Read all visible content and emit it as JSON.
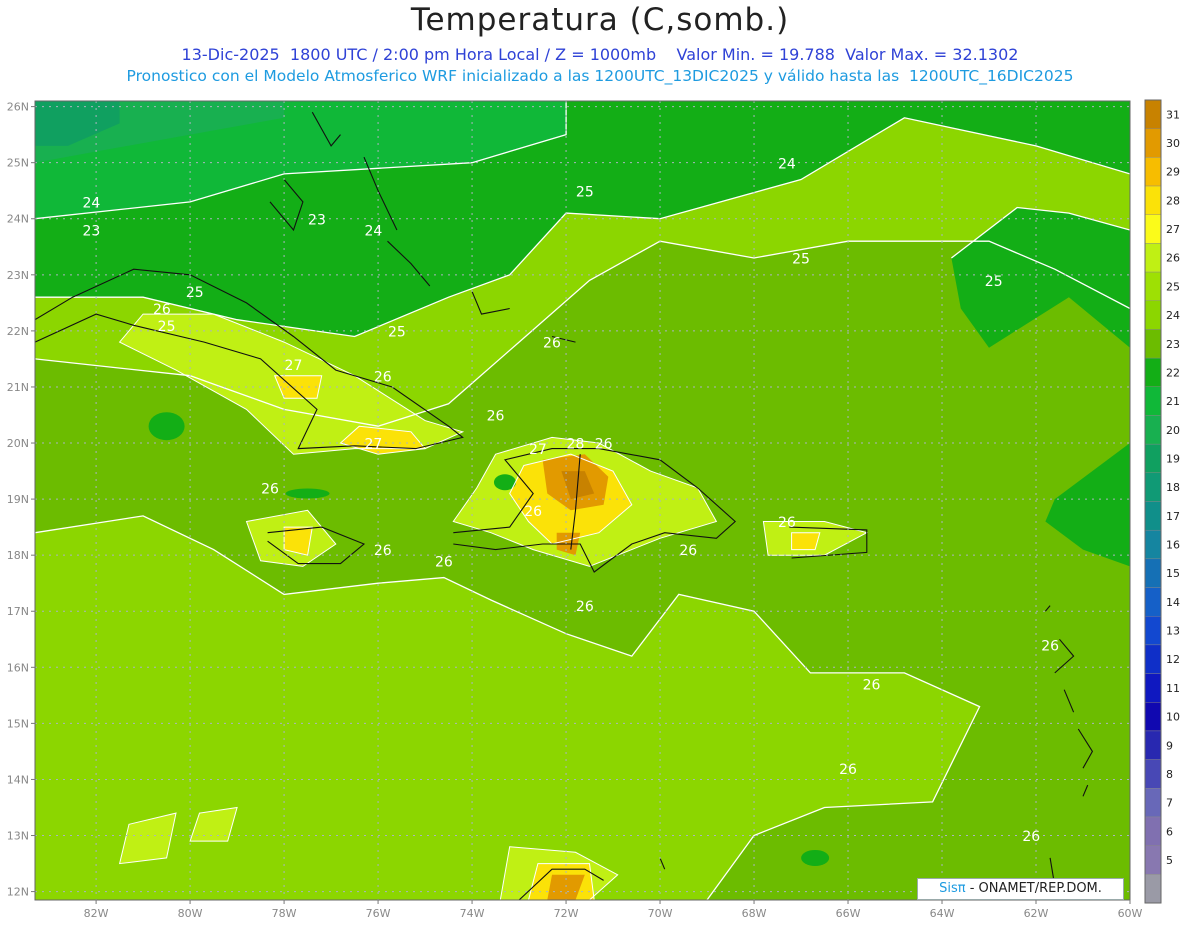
{
  "header": {
    "title": "Temperatura (C,somb.)",
    "subtitle_1": "13-Dic-2025  1800 UTC / 2:00 pm Hora Local / Z = 1000mb    Valor Min. = 19.788  Valor Max. = 32.1302",
    "subtitle_2": "Pronostico con el Modelo Atmosferico WRF inicializado a las 1200UTC_13DIC2025 y válido hasta las  1200UTC_16DIC2025"
  },
  "map": {
    "lat_labels": [
      "26N",
      "25N",
      "24N",
      "23N",
      "22N",
      "21N",
      "20N",
      "19N",
      "18N",
      "17N",
      "16N",
      "15N",
      "14N",
      "13N",
      "12N"
    ],
    "lon_labels": [
      "82W",
      "80W",
      "78W",
      "76W",
      "74W",
      "72W",
      "70W",
      "68W",
      "66W",
      "64W",
      "62W",
      "60W"
    ],
    "contour_labels": [
      {
        "text": "24",
        "lon": -67.3,
        "lat": 24.9
      },
      {
        "text": "23",
        "lon": -82.1,
        "lat": 23.7
      },
      {
        "text": "24",
        "lon": -82.1,
        "lat": 24.2
      },
      {
        "text": "23",
        "lon": -77.3,
        "lat": 23.9
      },
      {
        "text": "24",
        "lon": -76.1,
        "lat": 23.7
      },
      {
        "text": "25",
        "lon": -71.6,
        "lat": 24.4
      },
      {
        "text": "25",
        "lon": -67.0,
        "lat": 23.2
      },
      {
        "text": "25",
        "lon": -62.9,
        "lat": 22.8
      },
      {
        "text": "25",
        "lon": -79.9,
        "lat": 22.6
      },
      {
        "text": "26",
        "lon": -80.6,
        "lat": 22.3
      },
      {
        "text": "25",
        "lon": -80.5,
        "lat": 22.0
      },
      {
        "text": "25",
        "lon": -75.6,
        "lat": 21.9
      },
      {
        "text": "26",
        "lon": -72.3,
        "lat": 21.7
      },
      {
        "text": "27",
        "lon": -77.8,
        "lat": 21.3
      },
      {
        "text": "26",
        "lon": -75.9,
        "lat": 21.1
      },
      {
        "text": "26",
        "lon": -73.5,
        "lat": 20.4
      },
      {
        "text": "27",
        "lon": -76.1,
        "lat": 19.9
      },
      {
        "text": "27",
        "lon": -72.6,
        "lat": 19.8
      },
      {
        "text": "28",
        "lon": -71.8,
        "lat": 19.9
      },
      {
        "text": "26",
        "lon": -71.2,
        "lat": 19.9
      },
      {
        "text": "26",
        "lon": -78.3,
        "lat": 19.1
      },
      {
        "text": "26",
        "lon": -72.7,
        "lat": 18.7
      },
      {
        "text": "26",
        "lon": -67.3,
        "lat": 18.5
      },
      {
        "text": "26",
        "lon": -75.9,
        "lat": 18.0
      },
      {
        "text": "26",
        "lon": -74.6,
        "lat": 17.8
      },
      {
        "text": "26",
        "lon": -69.4,
        "lat": 18.0
      },
      {
        "text": "26",
        "lon": -71.6,
        "lat": 17.0
      },
      {
        "text": "26",
        "lon": -61.7,
        "lat": 16.3
      },
      {
        "text": "26",
        "lon": -65.5,
        "lat": 15.6
      },
      {
        "text": "26",
        "lon": -66.0,
        "lat": 14.1
      },
      {
        "text": "26",
        "lon": -62.1,
        "lat": 12.9
      }
    ]
  },
  "colorbar": {
    "labels": [
      "31",
      "30",
      "29",
      "28",
      "27",
      "26",
      "25",
      "24",
      "23",
      "22",
      "21",
      "20",
      "19",
      "18",
      "17",
      "16",
      "15",
      "14",
      "13",
      "12",
      "11",
      "10",
      "9",
      "8",
      "7",
      "6",
      "5"
    ],
    "colors": [
      "#c88200",
      "#e29a00",
      "#f7bd00",
      "#fbe208",
      "#fbfb1a",
      "#c0f014",
      "#9ee004",
      "#8cd600",
      "#6cbc00",
      "#13ae16",
      "#10b838",
      "#18b050",
      "#10a060",
      "#109a75",
      "#108f8a",
      "#1585a0",
      "#1570b5",
      "#1560c8",
      "#1248d0",
      "#0f2fc8",
      "#0f18c0",
      "#1008b0",
      "#2828b0",
      "#4848b5",
      "#6868b8",
      "#8070b0",
      "#8878b0",
      "#9a9aa6",
      "#aaaaaa",
      "#bcbcbc",
      "#d4d4d4",
      "#ffffff"
    ]
  },
  "credit": {
    "sis": "Sisπ",
    "org": " - ONAMET/REP.DOM."
  }
}
